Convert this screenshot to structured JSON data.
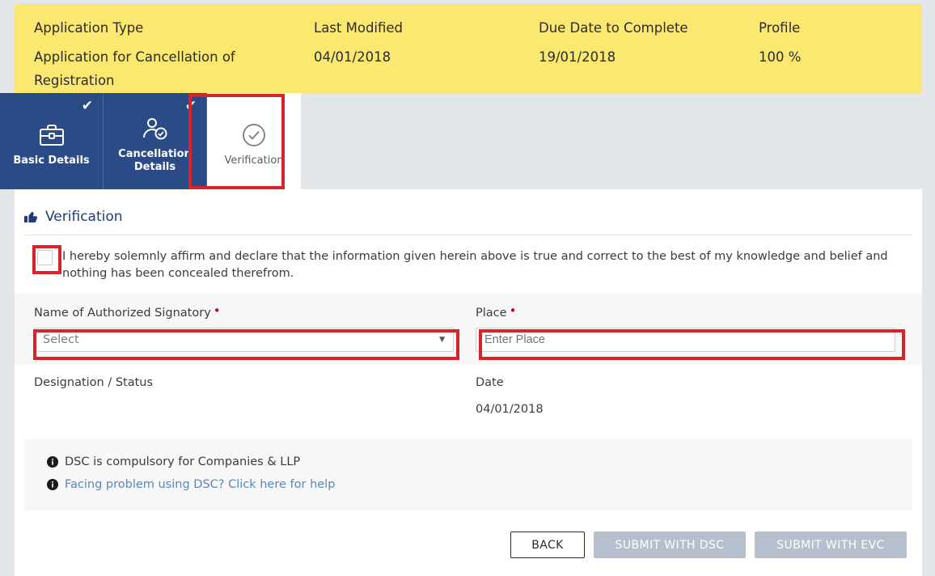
{
  "header": {
    "fields": [
      {
        "label": "Application Type",
        "value": "Application for Cancellation of Registration"
      },
      {
        "label": "Last Modified",
        "value": "04/01/2018"
      },
      {
        "label": "Due Date to Complete",
        "value": "19/01/2018"
      },
      {
        "label": "Profile",
        "value": "100 %"
      }
    ],
    "background_color": "#fbe870"
  },
  "tabs": [
    {
      "label": "Basic Details",
      "icon": "briefcase-icon",
      "completed": true,
      "active": false
    },
    {
      "label": "Cancellation Details",
      "icon": "user-check-icon",
      "completed": true,
      "active": false
    },
    {
      "label": "Verification",
      "icon": "circle-check-icon",
      "completed": false,
      "active": true
    }
  ],
  "tab_colors": {
    "inactive_bg": "#2b4b87",
    "active_bg": "#ffffff",
    "strip_bg": "#e3e7ea"
  },
  "highlight": {
    "color": "#d8232a"
  },
  "verification": {
    "title": "Verification",
    "title_icon": "thumbs-up-icon",
    "declaration": "I hereby solemnly affirm and declare that the information given herein above is true and correct to the best of my knowledge and belief and nothing has been concealed therefrom.",
    "checkbox_checked": false,
    "signatory": {
      "label": "Name of Authorized Signatory",
      "required_marker": "•",
      "selected": "Select",
      "caret_icon": "chevron-down-icon"
    },
    "place": {
      "label": "Place",
      "required_marker": "•",
      "value": "",
      "placeholder": "Enter Place"
    },
    "designation": {
      "label": "Designation / Status",
      "value": ""
    },
    "date": {
      "label": "Date",
      "value": "04/01/2018"
    },
    "notes": [
      {
        "icon": "info-icon",
        "text": "DSC is compulsory for Companies & LLP",
        "is_link": false
      },
      {
        "icon": "info-icon",
        "text": "Facing problem using DSC? Click here for help",
        "is_link": true
      }
    ]
  },
  "actions": {
    "back": "BACK",
    "submit_dsc": "SUBMIT WITH DSC",
    "submit_evc": "SUBMIT WITH EVC"
  }
}
